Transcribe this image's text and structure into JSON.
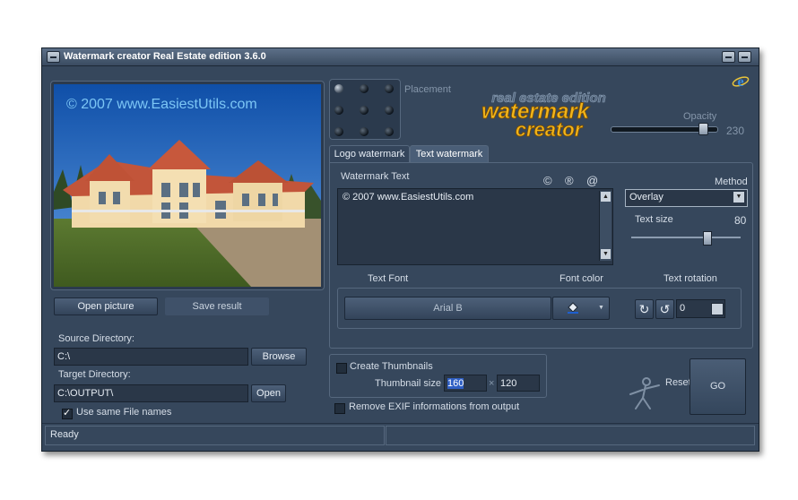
{
  "window": {
    "title": "Watermark creator Real Estate edition 3.6.0"
  },
  "preview": {
    "watermark_text": "© 2007 www.EasiestUtils.com"
  },
  "buttons": {
    "open_picture": "Open picture",
    "save_result": "Save result",
    "browse": "Browse",
    "open": "Open",
    "go": "GO",
    "reset_defaults": "Reset to defaults"
  },
  "source": {
    "label": "Source Directory:",
    "value": "C:\\"
  },
  "target": {
    "label": "Target Directory:",
    "value": "C:\\OUTPUT\\"
  },
  "same_names": {
    "label": "Use same File names",
    "checked": true
  },
  "placement": {
    "label": "Placement"
  },
  "logo": {
    "line1": "real estate edition",
    "line2": "watermark",
    "line3": "creator"
  },
  "opacity": {
    "label": "Opacity",
    "value": "230",
    "fraction": 0.9
  },
  "tabs": [
    {
      "label": "Logo watermark"
    },
    {
      "label": "Text watermark"
    }
  ],
  "watermark": {
    "label": "Watermark Text",
    "symbols": [
      "©",
      "®",
      "@"
    ],
    "text": "© 2007 www.EasiestUtils.com"
  },
  "method": {
    "label": "Method",
    "value": "Overlay"
  },
  "text_size": {
    "label": "Text size",
    "value": "80",
    "fraction": 0.7
  },
  "font": {
    "label": "Text Font",
    "value": "Arial B"
  },
  "font_color": {
    "label": "Font color"
  },
  "rotation": {
    "label": "Text rotation",
    "value": "0"
  },
  "thumbnails": {
    "label": "Create Thumbnails",
    "size_label": "Thumbnail size",
    "width": "160",
    "sep": "×",
    "height": "120"
  },
  "exif": {
    "label": "Remove EXIF informations from output"
  },
  "status": {
    "text": "Ready"
  }
}
